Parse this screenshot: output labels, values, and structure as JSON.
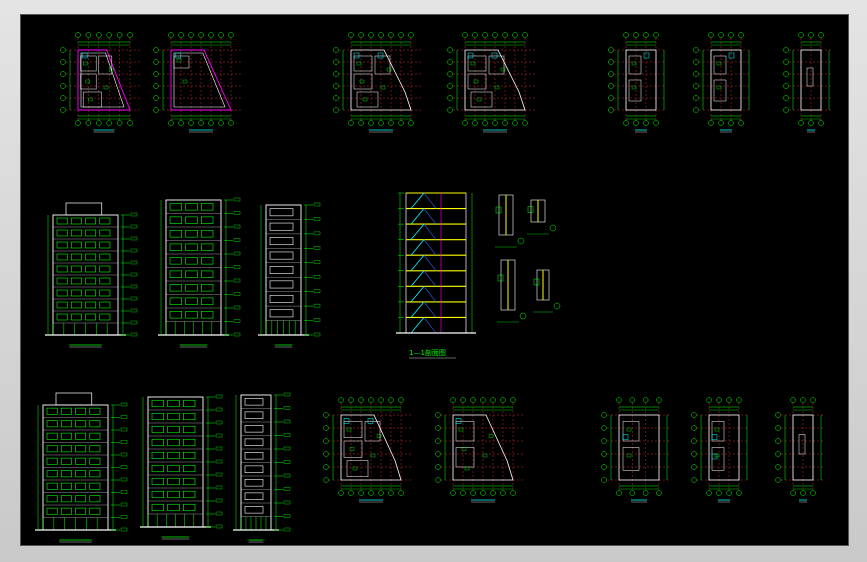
{
  "viewer": {
    "background": "#000000",
    "frame_color": "#d6d6d6"
  },
  "colors": {
    "green": "#00ff00",
    "white": "#ffffff",
    "red": "#ff3030",
    "magenta": "#ff00ff",
    "cyan": "#00ffff",
    "yellow": "#ffff00",
    "blue": "#3060ff"
  },
  "sections": {
    "section_title": "1—1剖面图"
  }
}
